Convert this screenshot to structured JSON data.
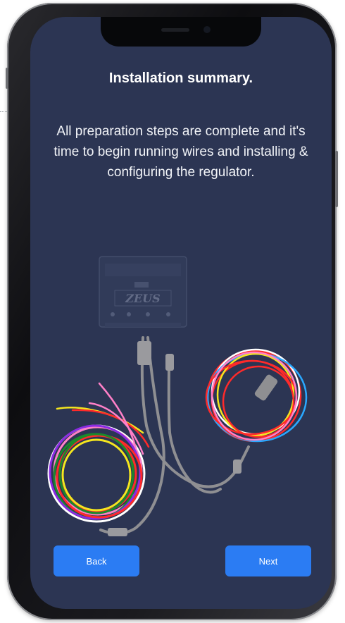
{
  "screen": {
    "title": "Installation summary.",
    "description": "All preparation steps are complete and it's time to begin running wires and installing & configuring the regulator.",
    "illustration": {
      "device_brand": "ZEUS",
      "wire_colors": [
        "#ff2a2a",
        "#f5e61e",
        "#1a8a2b",
        "#ff80c8",
        "#ffffff",
        "#2aa8ff",
        "#8a2be2",
        "#ff8c00"
      ]
    }
  },
  "buttons": {
    "back_label": "Back",
    "next_label": "Next"
  },
  "colors": {
    "screen_bg": "#2c3553",
    "button_bg": "#2b7cf3",
    "frame": "#101013"
  }
}
